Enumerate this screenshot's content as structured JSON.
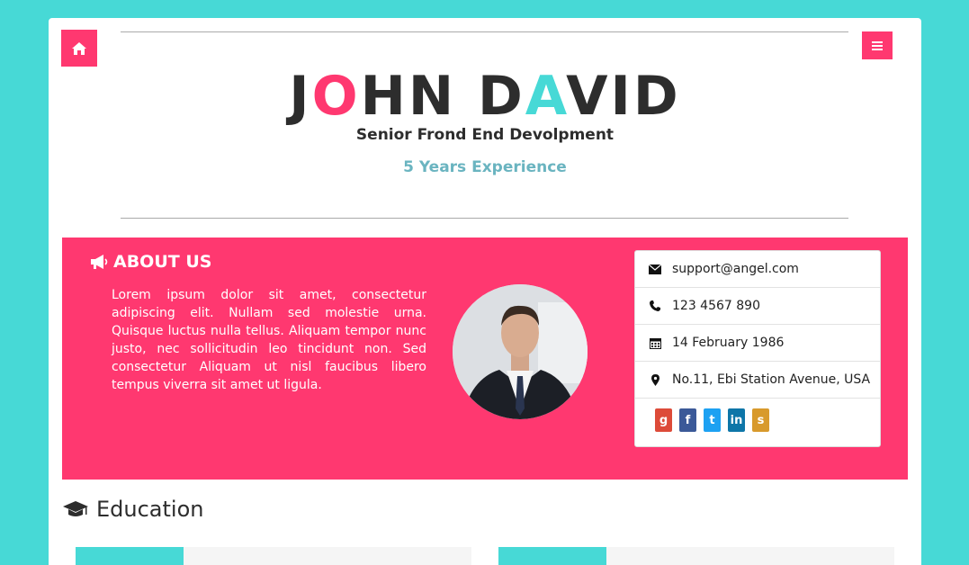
{
  "header": {
    "name_part1": "J",
    "name_accent1": "O",
    "name_part2": "HN D",
    "name_accent2": "A",
    "name_part3": "VID",
    "role": "Senior Frond End Devolpment",
    "experience": "5 Years Experience"
  },
  "nav": {
    "home_icon": "home-icon",
    "menu_icon": "hamburger-menu-icon"
  },
  "about": {
    "title": "ABOUT US",
    "text": "Lorem ipsum dolor sit amet, consectetur adipiscing elit. Nullam sed molestie urna. Quisque luctus nulla tellus. Aliquam tempor nunc justo, nec sollicitudin leo tincidunt non. Sed consectetur Aliquam ut nisl faucibus libero tempus viverra sit amet ut ligula."
  },
  "contact": {
    "email": "support@angel.com",
    "phone": "123 4567 890",
    "birthday": "14 February 1986",
    "address": "No.11, Ebi Station Avenue, USA",
    "social": [
      {
        "icon": "google-plus-icon",
        "glyph": "g",
        "color": "#dd4b39"
      },
      {
        "icon": "facebook-icon",
        "glyph": "f",
        "color": "#3b5998"
      },
      {
        "icon": "twitter-icon",
        "glyph": "t",
        "color": "#1da1f2"
      },
      {
        "icon": "linkedin-icon",
        "glyph": "in",
        "color": "#0e76a8"
      },
      {
        "icon": "stackoverflow-icon",
        "glyph": "s",
        "color": "#d89a2c"
      }
    ]
  },
  "education": {
    "title": "Education"
  },
  "colors": {
    "background": "#47d9d6",
    "accent": "#ff3870",
    "experience": "#6ab4c0"
  }
}
